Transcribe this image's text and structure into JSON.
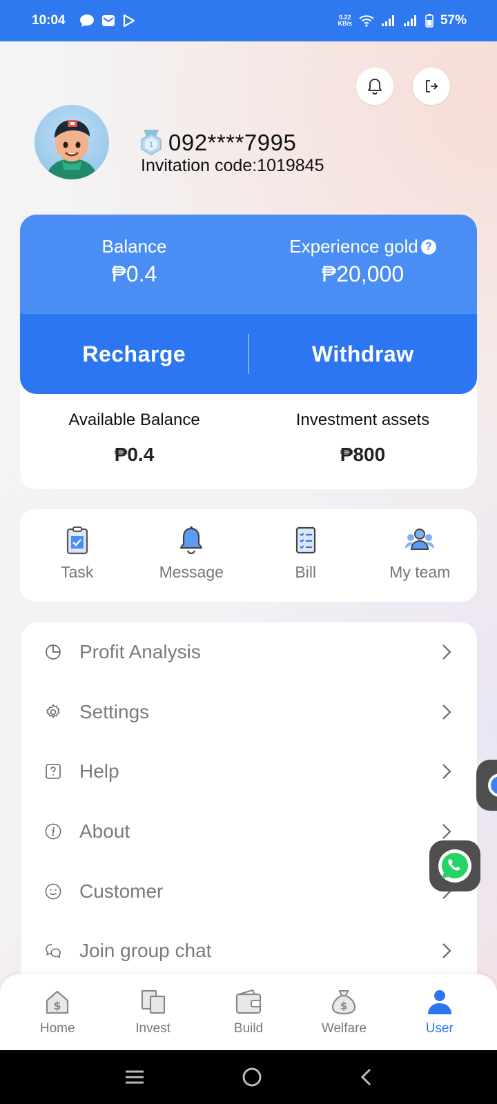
{
  "status_bar": {
    "time": "10:04",
    "net_speed_top": "0.22",
    "net_speed_bottom": "KB/s",
    "battery": "57%"
  },
  "profile": {
    "phone": "092****7995",
    "invitation_code": "Invitation code:1019845"
  },
  "balance_card": {
    "balance_label": "Balance",
    "balance_value": "₱0.4",
    "experience_label": "Experience gold",
    "experience_value": "₱20,000",
    "recharge_label": "Recharge",
    "withdraw_label": "Withdraw",
    "available_label": "Available Balance",
    "available_value": "₱0.4",
    "assets_label": "Investment assets",
    "assets_value": "₱800"
  },
  "quick_actions": [
    {
      "label": "Task",
      "icon": "clipboard-check-icon"
    },
    {
      "label": "Message",
      "icon": "bell-icon"
    },
    {
      "label": "Bill",
      "icon": "bill-list-icon"
    },
    {
      "label": "My team",
      "icon": "team-icon"
    }
  ],
  "menu": [
    {
      "label": "Profit Analysis",
      "icon": "pie-chart-icon"
    },
    {
      "label": "Settings",
      "icon": "gear-icon"
    },
    {
      "label": "Help",
      "icon": "question-icon"
    },
    {
      "label": "About",
      "icon": "info-icon"
    },
    {
      "label": "Customer",
      "icon": "smiley-icon"
    },
    {
      "label": "Join group chat",
      "icon": "chat-icon"
    }
  ],
  "bottom_nav": [
    {
      "label": "Home",
      "icon": "home-icon",
      "active": false
    },
    {
      "label": "Invest",
      "icon": "invest-icon",
      "active": false
    },
    {
      "label": "Build",
      "icon": "wallet-icon",
      "active": false
    },
    {
      "label": "Welfare",
      "icon": "money-bag-icon",
      "active": false
    },
    {
      "label": "User",
      "icon": "user-icon",
      "active": true
    }
  ],
  "colors": {
    "primary": "#2d76f1",
    "primary_light": "#4a8ef5",
    "status_bar": "#2f79f0",
    "whatsapp": "#25d366"
  }
}
